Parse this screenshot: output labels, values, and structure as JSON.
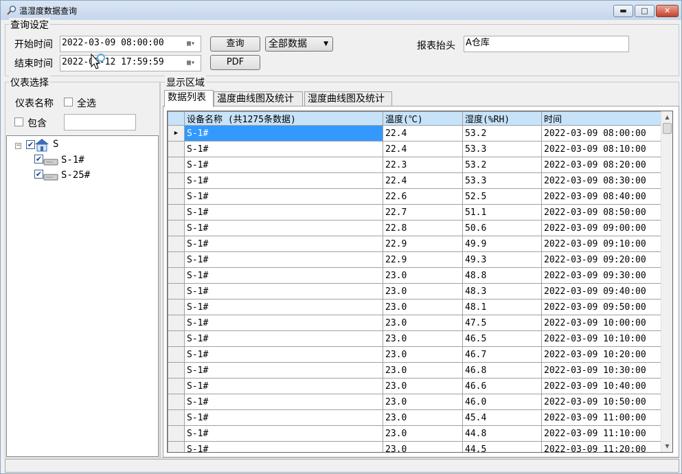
{
  "window": {
    "title": "温湿度数据查询",
    "controls": {
      "minimize": "▬",
      "maximize": "□",
      "close": "✕"
    }
  },
  "query": {
    "group_title": "查询设定",
    "start_label": "开始时间",
    "start_value": "2022-03-09 08:00:00",
    "end_label": "结束时间",
    "end_value": "2022-03-12 17:59:59",
    "query_button": "查询",
    "pdf_button": "PDF",
    "data_range_select": "全部数据",
    "report_header_label": "报表抬头",
    "report_header_value": "A仓库"
  },
  "instrument": {
    "group_title": "仪表选择",
    "name_label": "仪表名称",
    "select_all_label": "全选",
    "select_all_checked": false,
    "contains_label": "包含",
    "contains_checked": false,
    "contains_value": "",
    "tree": {
      "root_label": "S",
      "root_expander": "−",
      "children": [
        {
          "label": "S-1#",
          "checked": true
        },
        {
          "label": "S-25#",
          "checked": true
        }
      ]
    }
  },
  "display": {
    "group_title": "显示区域",
    "tabs": [
      "数据列表",
      "温度曲线图及统计",
      "湿度曲线图及统计"
    ],
    "active_tab": 0,
    "grid": {
      "columns": [
        "设备名称 (共1275条数据)",
        "温度(℃)",
        "湿度(%RH)",
        "时间"
      ],
      "current_row_marker": "▶",
      "rows": [
        [
          "S-1#",
          "22.4",
          "53.2",
          "2022-03-09 08:00:00"
        ],
        [
          "S-1#",
          "22.4",
          "53.3",
          "2022-03-09 08:10:00"
        ],
        [
          "S-1#",
          "22.3",
          "53.2",
          "2022-03-09 08:20:00"
        ],
        [
          "S-1#",
          "22.4",
          "53.3",
          "2022-03-09 08:30:00"
        ],
        [
          "S-1#",
          "22.6",
          "52.5",
          "2022-03-09 08:40:00"
        ],
        [
          "S-1#",
          "22.7",
          "51.1",
          "2022-03-09 08:50:00"
        ],
        [
          "S-1#",
          "22.8",
          "50.6",
          "2022-03-09 09:00:00"
        ],
        [
          "S-1#",
          "22.9",
          "49.9",
          "2022-03-09 09:10:00"
        ],
        [
          "S-1#",
          "22.9",
          "49.3",
          "2022-03-09 09:20:00"
        ],
        [
          "S-1#",
          "23.0",
          "48.8",
          "2022-03-09 09:30:00"
        ],
        [
          "S-1#",
          "23.0",
          "48.3",
          "2022-03-09 09:40:00"
        ],
        [
          "S-1#",
          "23.0",
          "48.1",
          "2022-03-09 09:50:00"
        ],
        [
          "S-1#",
          "23.0",
          "47.5",
          "2022-03-09 10:00:00"
        ],
        [
          "S-1#",
          "23.0",
          "46.5",
          "2022-03-09 10:10:00"
        ],
        [
          "S-1#",
          "23.0",
          "46.7",
          "2022-03-09 10:20:00"
        ],
        [
          "S-1#",
          "23.0",
          "46.8",
          "2022-03-09 10:30:00"
        ],
        [
          "S-1#",
          "23.0",
          "46.6",
          "2022-03-09 10:40:00"
        ],
        [
          "S-1#",
          "23.0",
          "46.0",
          "2022-03-09 10:50:00"
        ],
        [
          "S-1#",
          "23.0",
          "45.4",
          "2022-03-09 11:00:00"
        ],
        [
          "S-1#",
          "23.0",
          "44.8",
          "2022-03-09 11:10:00"
        ],
        [
          "S-1#",
          "23.0",
          "44.5",
          "2022-03-09 11:20:00"
        ]
      ]
    },
    "scroll": {
      "up": "▲",
      "down": "▼"
    }
  },
  "icons": {
    "title": "magnifier-icon",
    "calendar": "calendar-icon",
    "dropdown": "▾",
    "tree_root": "house-icon",
    "tree_device": "device-icon"
  },
  "status_bar_text": ""
}
